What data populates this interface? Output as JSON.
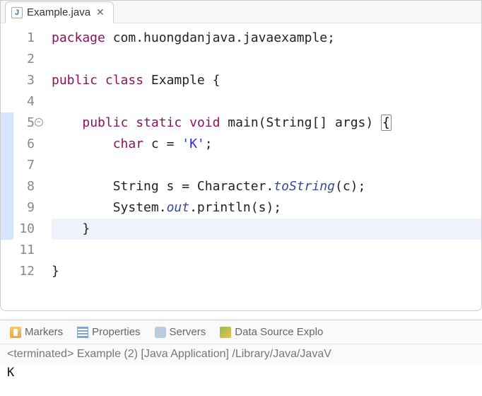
{
  "tab": {
    "filename": "Example.java"
  },
  "code": {
    "lines": [
      {
        "n": 1,
        "marker": "",
        "hl": false,
        "tokens": [
          {
            "c": "kw",
            "t": "package"
          },
          {
            "c": "plain",
            "t": " com.huongdanjava.javaexample;"
          }
        ]
      },
      {
        "n": 2,
        "marker": "",
        "hl": false,
        "tokens": []
      },
      {
        "n": 3,
        "marker": "",
        "hl": false,
        "tokens": [
          {
            "c": "kw",
            "t": "public"
          },
          {
            "c": "plain",
            "t": " "
          },
          {
            "c": "kw",
            "t": "class"
          },
          {
            "c": "plain",
            "t": " Example {"
          }
        ]
      },
      {
        "n": 4,
        "marker": "",
        "hl": false,
        "tokens": []
      },
      {
        "n": 5,
        "marker": "blue",
        "fold": true,
        "hl": false,
        "tokens": [
          {
            "c": "plain",
            "t": "    "
          },
          {
            "c": "kw",
            "t": "public"
          },
          {
            "c": "plain",
            "t": " "
          },
          {
            "c": "kw",
            "t": "static"
          },
          {
            "c": "plain",
            "t": " "
          },
          {
            "c": "kw",
            "t": "void"
          },
          {
            "c": "plain",
            "t": " main(String[] args) "
          },
          {
            "c": "bracket-hl",
            "t": "{"
          }
        ]
      },
      {
        "n": 6,
        "marker": "blue",
        "hl": false,
        "tokens": [
          {
            "c": "plain",
            "t": "        "
          },
          {
            "c": "kw",
            "t": "char"
          },
          {
            "c": "plain",
            "t": " c = "
          },
          {
            "c": "str",
            "t": "'K'"
          },
          {
            "c": "plain",
            "t": ";"
          }
        ]
      },
      {
        "n": 7,
        "marker": "blue",
        "hl": false,
        "tokens": []
      },
      {
        "n": 8,
        "marker": "blue",
        "hl": false,
        "tokens": [
          {
            "c": "plain",
            "t": "        String s = Character."
          },
          {
            "c": "static-ref",
            "t": "toString"
          },
          {
            "c": "plain",
            "t": "(c);"
          }
        ]
      },
      {
        "n": 9,
        "marker": "blue",
        "hl": false,
        "tokens": [
          {
            "c": "plain",
            "t": "        System."
          },
          {
            "c": "static-ref",
            "t": "out"
          },
          {
            "c": "plain",
            "t": ".println(s);"
          }
        ]
      },
      {
        "n": 10,
        "marker": "blue",
        "hl": true,
        "tokens": [
          {
            "c": "plain",
            "t": "    }"
          }
        ]
      },
      {
        "n": 11,
        "marker": "",
        "hl": false,
        "tokens": []
      },
      {
        "n": 12,
        "marker": "",
        "hl": false,
        "tokens": [
          {
            "c": "plain",
            "t": "}"
          }
        ]
      }
    ]
  },
  "console": {
    "tabs": {
      "markers": "Markers",
      "properties": "Properties",
      "servers": "Servers",
      "datasource": "Data Source Explo"
    },
    "status": "<terminated> Example (2) [Java Application] /Library/Java/JavaV",
    "output": "K"
  },
  "icons": {
    "java": "J",
    "close": "✕",
    "fold": "−"
  }
}
